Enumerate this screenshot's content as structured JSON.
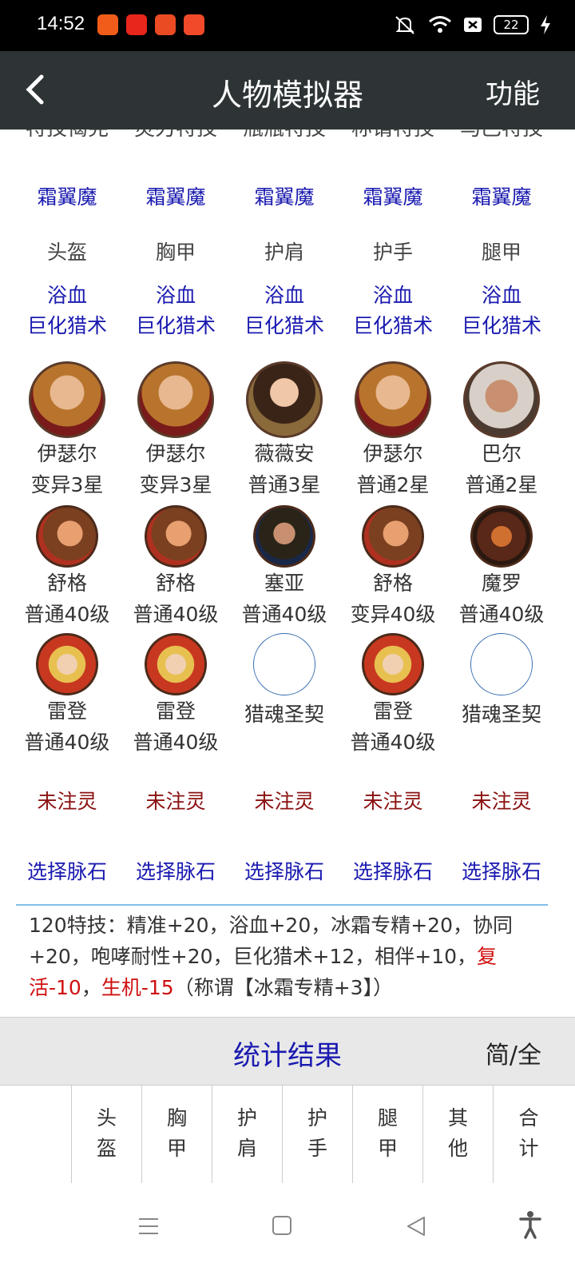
{
  "status_bar": {
    "time": "14:52",
    "battery": "22"
  },
  "header": {
    "title": "人物模拟器",
    "function_label": "功能"
  },
  "cut_row": [
    "特技偈宪",
    "灵刃特技",
    "瓶瓶特技",
    "称谓特技",
    "马巴特技"
  ],
  "frost_row": [
    "霜翼魔",
    "霜翼魔",
    "霜翼魔",
    "霜翼魔",
    "霜翼魔"
  ],
  "slot_row": [
    "头盔",
    "胸甲",
    "护肩",
    "护手",
    "腿甲"
  ],
  "skill_row_1": [
    "浴血",
    "浴血",
    "浴血",
    "浴血",
    "浴血"
  ],
  "skill_row_2": [
    "巨化猎术",
    "巨化猎术",
    "巨化猎术",
    "巨化猎术",
    "巨化猎术"
  ],
  "heroes": [
    {
      "name": "伊瑟尔",
      "grade": "变异3星"
    },
    {
      "name": "伊瑟尔",
      "grade": "变异3星"
    },
    {
      "name": "薇薇安",
      "grade": "普通3星"
    },
    {
      "name": "伊瑟尔",
      "grade": "普通2星"
    },
    {
      "name": "巴尔",
      "grade": "普通2星"
    }
  ],
  "pets_1": [
    {
      "name": "舒格",
      "grade": "普通40级"
    },
    {
      "name": "舒格",
      "grade": "普通40级"
    },
    {
      "name": "塞亚",
      "grade": "普通40级"
    },
    {
      "name": "舒格",
      "grade": "变异40级"
    },
    {
      "name": "魔罗",
      "grade": "普通40级"
    }
  ],
  "pets_2": [
    {
      "name": "雷登",
      "grade": "普通40级"
    },
    {
      "name": "雷登",
      "grade": "普通40级"
    },
    {
      "name": "猎魂圣契",
      "grade": ""
    },
    {
      "name": "雷登",
      "grade": "普通40级"
    },
    {
      "name": "猎魂圣契",
      "grade": ""
    }
  ],
  "spirit_row": [
    "未注灵",
    "未注灵",
    "未注灵",
    "未注灵",
    "未注灵"
  ],
  "vein_row": [
    "选择脉石",
    "选择脉石",
    "选择脉石",
    "选择脉石",
    "选择脉石"
  ],
  "desc": {
    "part1": "120特技：精准+20，浴血+20，冰霜专精+20，协同+20，咆哮耐性+20，巨化猎术+12，相伴+10，",
    "red1": "复活-10",
    "sep": "，",
    "red2": "生机-15",
    "part2": "（称谓【冰霜专精+3】）"
  },
  "stats": {
    "title": "统计结果",
    "toggle": "简/全"
  },
  "table_headers": [
    [
      "",
      ""
    ],
    [
      "头",
      "盔"
    ],
    [
      "胸",
      "甲"
    ],
    [
      "护",
      "肩"
    ],
    [
      "护",
      "手"
    ],
    [
      "腿",
      "甲"
    ],
    [
      "其",
      "他"
    ],
    [
      "合",
      "计"
    ]
  ],
  "colors": {
    "header_bg": "#2e3436",
    "link_blue": "#1a1ab0",
    "spirit_red": "#8b1010",
    "warn_red": "#d01010"
  }
}
